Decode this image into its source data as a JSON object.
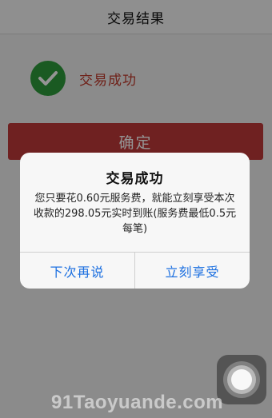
{
  "nav": {
    "title": "交易结果"
  },
  "result": {
    "text": "交易成功",
    "icon": "check-icon"
  },
  "confirm_button": {
    "label": "确定"
  },
  "alert": {
    "title": "交易成功",
    "message": "您只要花0.60元服务费，就能立刻享受本次收款的298.05元实时到账(服务费最低0.5元每笔)",
    "buttons": {
      "cancel": "下次再说",
      "accept": "立刻享受"
    }
  },
  "watermark": {
    "text": "91Taoyuande.com"
  },
  "colors": {
    "nav_bg": "#f7f7f7",
    "success_green": "#2e9b3b",
    "result_text_red": "#c0392b",
    "confirm_button_red": "#c03a3a",
    "alert_button_blue": "#1b6fe0"
  }
}
